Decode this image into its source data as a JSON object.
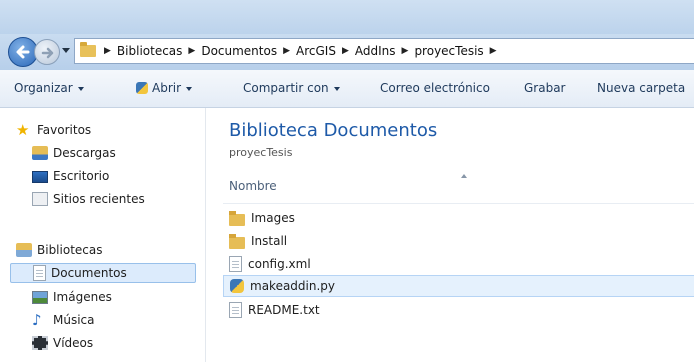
{
  "breadcrumb": [
    "Bibliotecas",
    "Documentos",
    "ArcGIS",
    "AddIns",
    "proyecTesis"
  ],
  "toolbar": {
    "organize": "Organizar",
    "open": "Abrir",
    "share": "Compartir con",
    "email": "Correo electrónico",
    "burn": "Grabar",
    "new_folder": "Nueva carpeta"
  },
  "nav": {
    "favorites": "Favoritos",
    "downloads": "Descargas",
    "desktop": "Escritorio",
    "recent": "Sitios recientes",
    "libraries": "Bibliotecas",
    "documents": "Documentos",
    "pictures": "Imágenes",
    "music": "Música",
    "videos": "Vídeos"
  },
  "content": {
    "title": "Biblioteca Documentos",
    "subtitle": "proyecTesis",
    "column_name": "Nombre",
    "files": [
      {
        "name": "Images",
        "icon": "folder-icon"
      },
      {
        "name": "Install",
        "icon": "folder-icon"
      },
      {
        "name": "config.xml",
        "icon": "xml-file-icon"
      },
      {
        "name": "makeaddin.py",
        "icon": "python-file-icon"
      },
      {
        "name": "README.txt",
        "icon": "text-file-icon"
      }
    ]
  },
  "colors": {
    "accent_title": "#1e5aa8",
    "selection": "#e5f1fd"
  }
}
